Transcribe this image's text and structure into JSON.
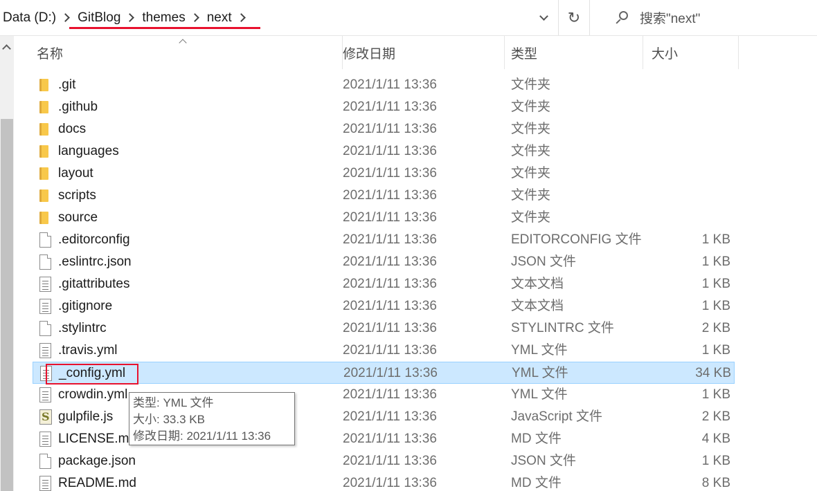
{
  "breadcrumb": [
    "Data (D:)",
    "GitBlog",
    "themes",
    "next"
  ],
  "refresh_glyph": "↻",
  "search": {
    "placeholder": "搜索\"next\""
  },
  "columns": {
    "name": "名称",
    "date": "修改日期",
    "type": "类型",
    "size": "大小"
  },
  "files": [
    {
      "name": ".git",
      "date": "2021/1/11 13:36",
      "type": "文件夹",
      "size": "",
      "icon": "folder-icon"
    },
    {
      "name": ".github",
      "date": "2021/1/11 13:36",
      "type": "文件夹",
      "size": "",
      "icon": "folder-icon"
    },
    {
      "name": "docs",
      "date": "2021/1/11 13:36",
      "type": "文件夹",
      "size": "",
      "icon": "folder-icon"
    },
    {
      "name": "languages",
      "date": "2021/1/11 13:36",
      "type": "文件夹",
      "size": "",
      "icon": "folder-icon"
    },
    {
      "name": "layout",
      "date": "2021/1/11 13:36",
      "type": "文件夹",
      "size": "",
      "icon": "folder-icon"
    },
    {
      "name": "scripts",
      "date": "2021/1/11 13:36",
      "type": "文件夹",
      "size": "",
      "icon": "folder-icon"
    },
    {
      "name": "source",
      "date": "2021/1/11 13:36",
      "type": "文件夹",
      "size": "",
      "icon": "folder-icon"
    },
    {
      "name": ".editorconfig",
      "date": "2021/1/11 13:36",
      "type": "EDITORCONFIG 文件",
      "size": "1 KB",
      "icon": "file-icon"
    },
    {
      "name": ".eslintrc.json",
      "date": "2021/1/11 13:36",
      "type": "JSON 文件",
      "size": "1 KB",
      "icon": "file-icon"
    },
    {
      "name": ".gitattributes",
      "date": "2021/1/11 13:36",
      "type": "文本文档",
      "size": "1 KB",
      "icon": "text-file-icon"
    },
    {
      "name": ".gitignore",
      "date": "2021/1/11 13:36",
      "type": "文本文档",
      "size": "1 KB",
      "icon": "text-file-icon"
    },
    {
      "name": ".stylintrc",
      "date": "2021/1/11 13:36",
      "type": "STYLINTRC 文件",
      "size": "2 KB",
      "icon": "file-icon"
    },
    {
      "name": ".travis.yml",
      "date": "2021/1/11 13:36",
      "type": "YML 文件",
      "size": "1 KB",
      "icon": "text-file-icon"
    },
    {
      "name": "_config.yml",
      "date": "2021/1/11 13:36",
      "type": "YML 文件",
      "size": "34 KB",
      "icon": "text-file-icon",
      "selected": true
    },
    {
      "name": "crowdin.yml",
      "date": "2021/1/11 13:36",
      "type": "YML 文件",
      "size": "1 KB",
      "icon": "text-file-icon"
    },
    {
      "name": "gulpfile.js",
      "date": "2021/1/11 13:36",
      "type": "JavaScript 文件",
      "size": "2 KB",
      "icon": "js-file-icon"
    },
    {
      "name": "LICENSE.md",
      "date": "2021/1/11 13:36",
      "type": "MD 文件",
      "size": "4 KB",
      "icon": "text-file-icon"
    },
    {
      "name": "package.json",
      "date": "2021/1/11 13:36",
      "type": "JSON 文件",
      "size": "1 KB",
      "icon": "file-icon"
    },
    {
      "name": "README.md",
      "date": "2021/1/11 13:36",
      "type": "MD 文件",
      "size": "8 KB",
      "icon": "text-file-icon"
    }
  ],
  "tooltip": {
    "type_line": "类型: YML 文件",
    "size_line": "大小: 33.3 KB",
    "date_line": "修改日期: 2021/1/11 13:36"
  },
  "colors": {
    "selection": "#cce8ff",
    "highlight": "#e8112d",
    "folder": "#f8c84a"
  }
}
